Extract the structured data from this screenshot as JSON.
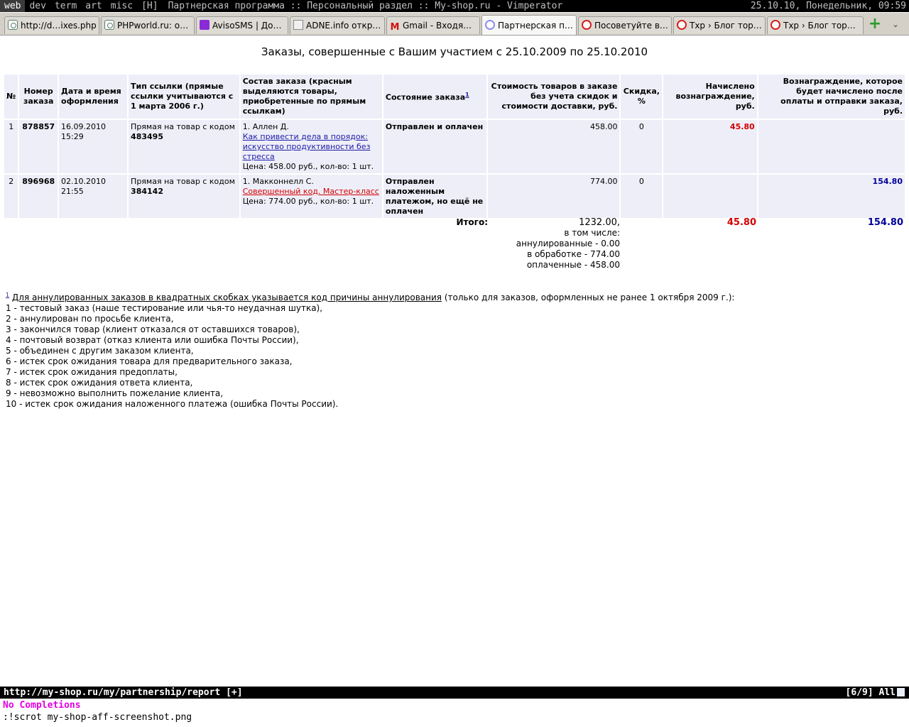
{
  "wm": {
    "tags": [
      "web",
      "dev",
      "term",
      "art",
      "misc",
      "[H]"
    ],
    "title": "Партнерская программа :: Персональный раздел :: My-shop.ru - Vimperator",
    "clock": "25.10.10, Понедельник, 09:59"
  },
  "tabs": [
    {
      "title": "http://d…ixes.php",
      "icon": "page-icon"
    },
    {
      "title": "PHPworld.ru: о…",
      "icon": "page-icon"
    },
    {
      "title": "AvisoSMS | До…",
      "icon": "mail-icon"
    },
    {
      "title": "ADNE.info откр…",
      "icon": "adne-icon"
    },
    {
      "title": "Gmail - Входя…",
      "icon": "gmail-icon"
    },
    {
      "title": "Партнерская п…",
      "icon": "loading-icon"
    },
    {
      "title": "Посоветуйте в…",
      "icon": "opera-icon"
    },
    {
      "title": "Txp › Блог тор…",
      "icon": "opera-icon"
    },
    {
      "title": "Txp › Блог тор…",
      "icon": "opera-icon"
    }
  ],
  "tab_add_icon": "plus-icon",
  "tab_menu_glyph": "⌄",
  "page": {
    "title": "Заказы, совершенные с Вашим участием с 25.10.2009 по 25.10.2010",
    "headers": {
      "num": "№",
      "order": "Номер заказа",
      "date": "Дата и время оформления",
      "link_type": "Тип ссылки (прямые ссылки учитываются с 1 марта 2006 г.)",
      "contents": "Состав заказа (красным выделяются товары, приобретенные по прямым ссылкам)",
      "status": "Состояние заказа",
      "status_footnote": "1",
      "cost": "Стоимость товаров в заказе без учета скидок и стоимости доставки, руб.",
      "discount": "Скидка, %",
      "accrued": "Начислено вознаграждение, руб.",
      "pending": "Вознаграждение, которое будет начислено после оплаты и отправки заказа, руб."
    },
    "rows": [
      {
        "n": "1",
        "order": "878857",
        "date": "16.09.2010 15:29",
        "link_type": "Прямая на товар с кодом",
        "code": "483495",
        "author": "1. Аллен Д.",
        "book": "Как привести дела в порядок: искусство продуктивности без стресса",
        "price": "Цена: 458.00 руб., кол-во: 1 шт.",
        "status": "Отправлен и оплачен",
        "cost": "458.00",
        "discount": "0",
        "accrued": "45.80",
        "pending": ""
      },
      {
        "n": "2",
        "order": "896968",
        "date": "02.10.2010 21:55",
        "link_type": "Прямая на товар с кодом",
        "code": "384142",
        "author": "1. Макконнелл С.",
        "book": "Совершенный код. Мастер-класс",
        "price": "Цена: 774.00 руб., кол-во: 1 шт.",
        "status": "Отправлен наложенным платежом, но ещё не оплачен",
        "cost": "774.00",
        "discount": "0",
        "accrued": "",
        "pending": "154.80"
      }
    ],
    "totals": {
      "label": "Итого:",
      "cost": "1232.00,",
      "incl": "в том числе:",
      "cancelled": "аннулированные - 0.00",
      "processing": "в обработке - 774.00",
      "paid": "оплаченные - 458.00",
      "accrued": "45.80",
      "pending": "154.80"
    },
    "notes": {
      "marker": "1",
      "intro_link": "Для аннулированных заказов в квадратных скобках указывается код причины аннулирования",
      "intro_rest": " (только для заказов, оформленных не ранее 1 октября 2009 г.):",
      "items": [
        "1 - тестовый заказ (наше тестирование или чья-то неудачная шутка),",
        "2 - аннулирован по просьбе клиента,",
        "3 - закончился товар (клиент отказался от оставшихся товаров),",
        "4 - почтовый возврат (отказ клиента или ошибка Почты России),",
        "5 - объединен с другим заказом клиента,",
        "6 - истек срок ожидания товара для предварительного заказа,",
        "7 - истек срок ожидания предоплаты,",
        "8 - истек срок ожидания ответа клиента,",
        "9 - невозможно выполнить пожелание клиента,",
        "10 - истек срок ожидания наложенного платежа (ошибка Почты России)."
      ]
    }
  },
  "vim": {
    "url": "http://my-shop.ru/my/partnership/report [+]",
    "position": "[6/9] All",
    "completions": "No Completions",
    "command": ":!scrot my-shop-aff-screenshot.png"
  }
}
